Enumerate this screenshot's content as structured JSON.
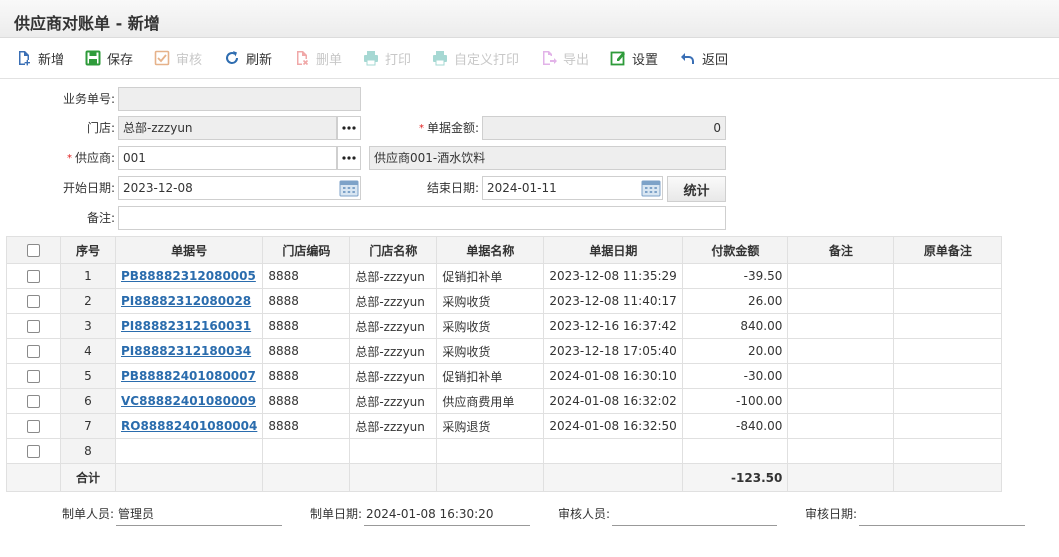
{
  "page": {
    "title": "供应商对账单 - 新增"
  },
  "toolbar": [
    {
      "name": "add-button",
      "icon": "file-add-icon",
      "label": "新增",
      "enabled": true
    },
    {
      "name": "save-button",
      "icon": "save-icon",
      "label": "保存",
      "enabled": true
    },
    {
      "name": "audit-button",
      "icon": "check-icon",
      "label": "审核",
      "enabled": false
    },
    {
      "name": "refresh-button",
      "icon": "refresh-icon",
      "label": "刷新",
      "enabled": true
    },
    {
      "name": "delete-button",
      "icon": "delete-doc-icon",
      "label": "删单",
      "enabled": false
    },
    {
      "name": "print-button",
      "icon": "printer-icon",
      "label": "打印",
      "enabled": false
    },
    {
      "name": "custom-print-button",
      "icon": "printer-icon",
      "label": "自定义打印",
      "enabled": false
    },
    {
      "name": "export-button",
      "icon": "export-icon",
      "label": "导出",
      "enabled": false
    },
    {
      "name": "settings-button",
      "icon": "edit-settings-icon",
      "label": "设置",
      "enabled": true
    },
    {
      "name": "back-button",
      "icon": "back-arrow-icon",
      "label": "返回",
      "enabled": true
    }
  ],
  "form": {
    "business_no": {
      "label": "业务单号:",
      "value": ""
    },
    "store": {
      "label": "门店:",
      "value": "总部-zzzyun"
    },
    "amount": {
      "label": "单据金额:",
      "value": "0"
    },
    "supplier": {
      "label": "供应商:",
      "value": "001",
      "name": "供应商001-酒水饮料"
    },
    "start_date": {
      "label": "开始日期:",
      "value": "2023-12-08"
    },
    "end_date": {
      "label": "结束日期:",
      "value": "2024-01-11"
    },
    "stat_button": "统计",
    "remark": {
      "label": "备注:",
      "value": ""
    }
  },
  "grid": {
    "columns": [
      "序号",
      "单据号",
      "门店编码",
      "门店名称",
      "单据名称",
      "单据日期",
      "付款金额",
      "备注",
      "原单备注"
    ],
    "rows": [
      {
        "seq": "1",
        "doc_no": "PB88882312080005",
        "store_code": "8888",
        "store_name": "总部-zzzyun",
        "doc_name": "促销扣补单",
        "doc_date": "2023-12-08 11:35:29",
        "amount": "-39.50",
        "remark": "",
        "orig_remark": ""
      },
      {
        "seq": "2",
        "doc_no": "PI88882312080028",
        "store_code": "8888",
        "store_name": "总部-zzzyun",
        "doc_name": "采购收货",
        "doc_date": "2023-12-08 11:40:17",
        "amount": "26.00",
        "remark": "",
        "orig_remark": ""
      },
      {
        "seq": "3",
        "doc_no": "PI88882312160031",
        "store_code": "8888",
        "store_name": "总部-zzzyun",
        "doc_name": "采购收货",
        "doc_date": "2023-12-16 16:37:42",
        "amount": "840.00",
        "remark": "",
        "orig_remark": ""
      },
      {
        "seq": "4",
        "doc_no": "PI88882312180034",
        "store_code": "8888",
        "store_name": "总部-zzzyun",
        "doc_name": "采购收货",
        "doc_date": "2023-12-18 17:05:40",
        "amount": "20.00",
        "remark": "",
        "orig_remark": ""
      },
      {
        "seq": "5",
        "doc_no": "PB88882401080007",
        "store_code": "8888",
        "store_name": "总部-zzzyun",
        "doc_name": "促销扣补单",
        "doc_date": "2024-01-08 16:30:10",
        "amount": "-30.00",
        "remark": "",
        "orig_remark": ""
      },
      {
        "seq": "6",
        "doc_no": "VC88882401080009",
        "store_code": "8888",
        "store_name": "总部-zzzyun",
        "doc_name": "供应商费用单",
        "doc_date": "2024-01-08 16:32:02",
        "amount": "-100.00",
        "remark": "",
        "orig_remark": ""
      },
      {
        "seq": "7",
        "doc_no": "RO88882401080004",
        "store_code": "8888",
        "store_name": "总部-zzzyun",
        "doc_name": "采购退货",
        "doc_date": "2024-01-08 16:32:50",
        "amount": "-840.00",
        "remark": "",
        "orig_remark": ""
      },
      {
        "seq": "8",
        "doc_no": "",
        "store_code": "",
        "store_name": "",
        "doc_name": "",
        "doc_date": "",
        "amount": "",
        "remark": "",
        "orig_remark": ""
      }
    ],
    "total": {
      "label": "合计",
      "amount": "-123.50"
    }
  },
  "footer": {
    "maker": {
      "label": "制单人员:",
      "value": "管理员"
    },
    "make_date": {
      "label": "制单日期:",
      "value": "2024-01-08 16:30:20"
    },
    "auditor": {
      "label": "审核人员:",
      "value": ""
    },
    "audit_date": {
      "label": "审核日期:",
      "value": ""
    }
  }
}
